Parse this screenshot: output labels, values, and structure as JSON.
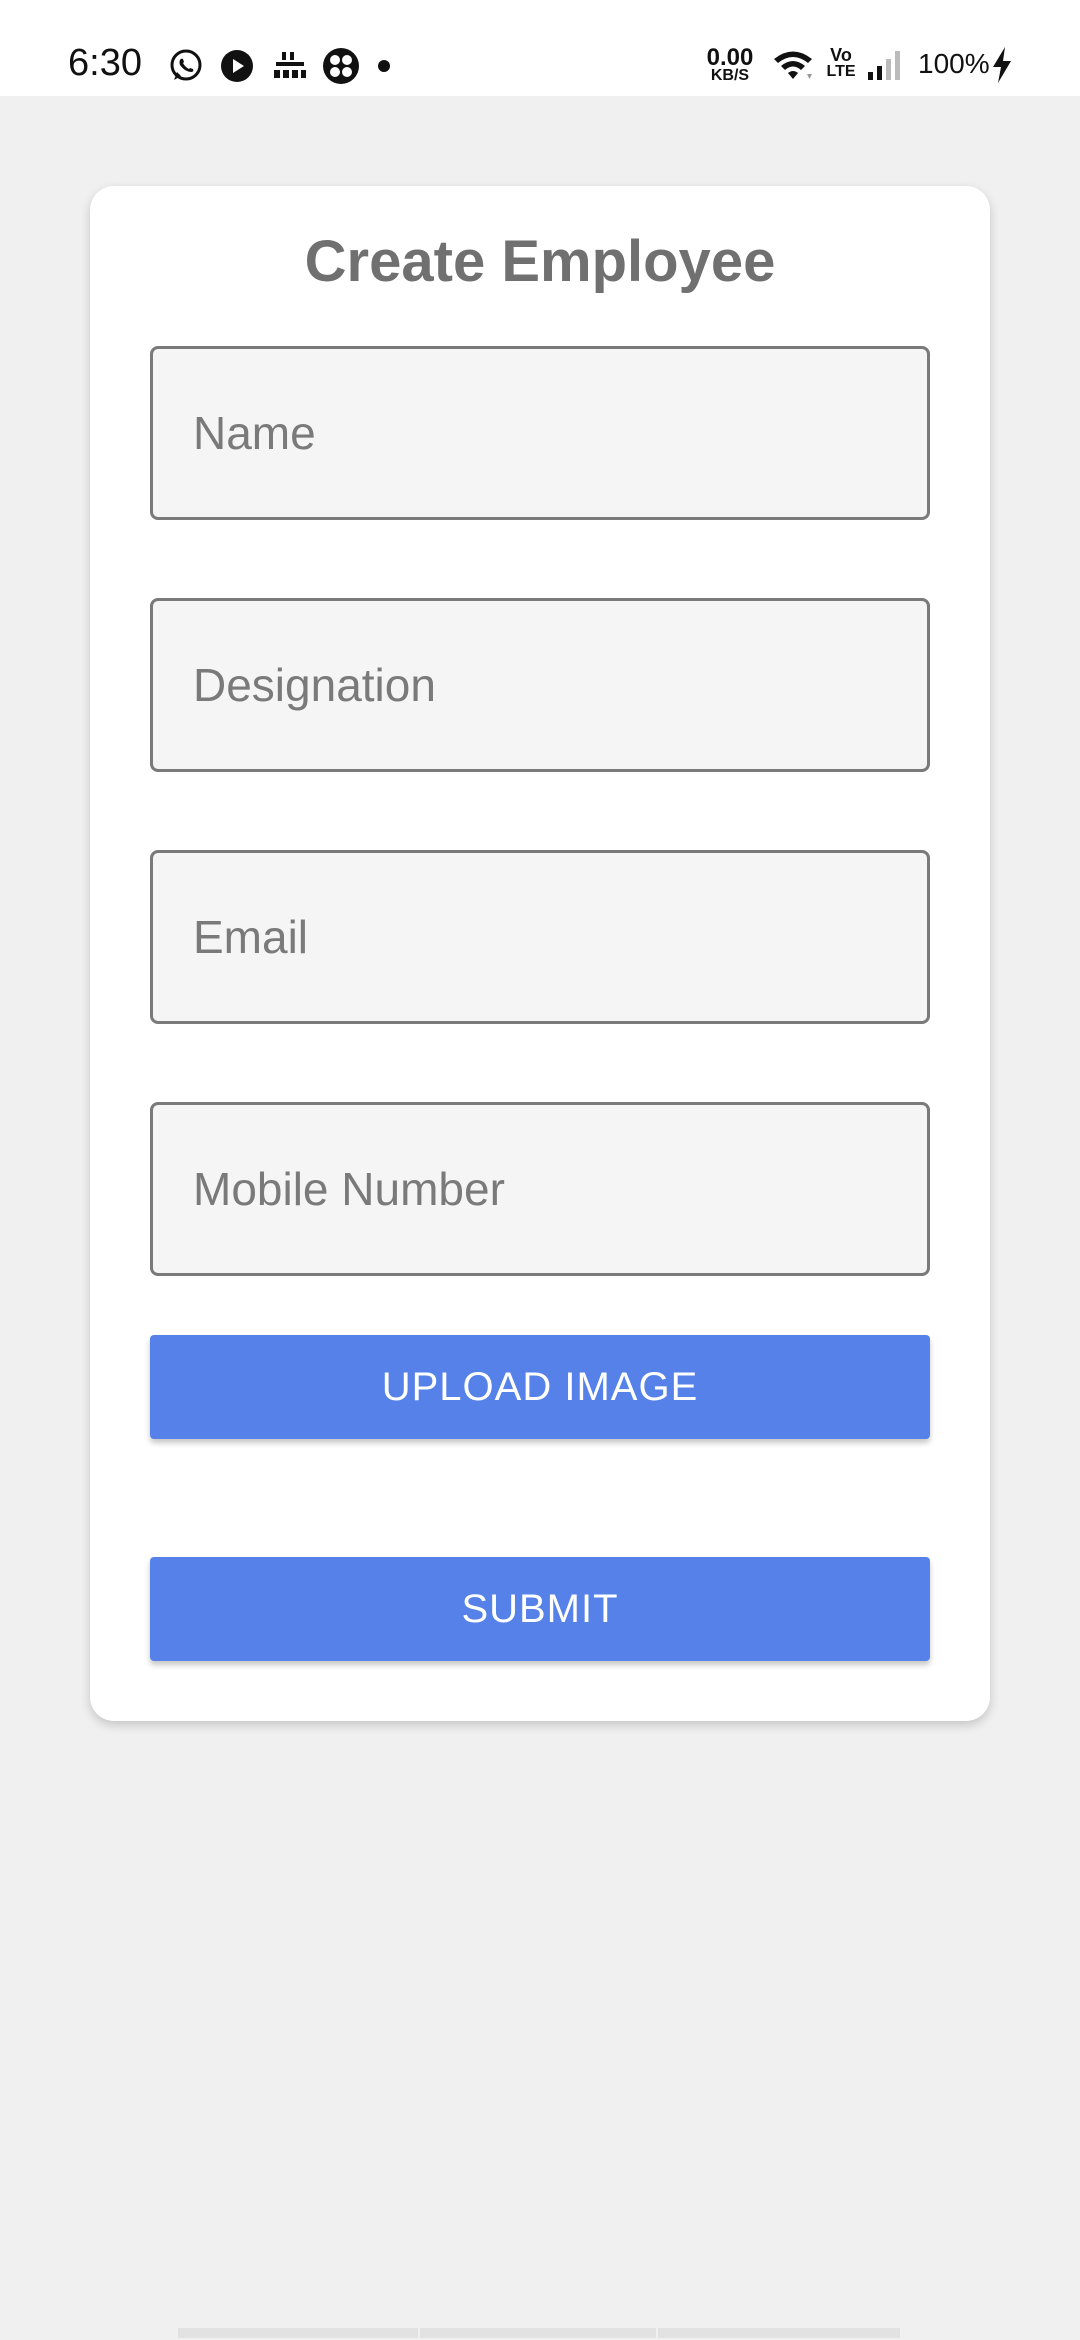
{
  "status_bar": {
    "time": "6:30",
    "notification_icons": [
      "whatsapp-icon",
      "play-icon",
      "news-app-icon",
      "fan-app-icon"
    ],
    "network_speed_value": "0.00",
    "network_speed_unit": "KB/S",
    "volte_top": "Vo",
    "volte_bottom": "LTE",
    "battery": "100%"
  },
  "form": {
    "title": "Create Employee",
    "fields": [
      {
        "placeholder": "Name",
        "value": ""
      },
      {
        "placeholder": "Designation",
        "value": ""
      },
      {
        "placeholder": "Email",
        "value": ""
      },
      {
        "placeholder": "Mobile Number",
        "value": ""
      }
    ],
    "upload_label": "UPLOAD IMAGE",
    "submit_label": "SUBMIT"
  },
  "colors": {
    "accent": "#5581e9",
    "background": "#f0f0f0",
    "card": "#ffffff",
    "title": "#707070"
  }
}
